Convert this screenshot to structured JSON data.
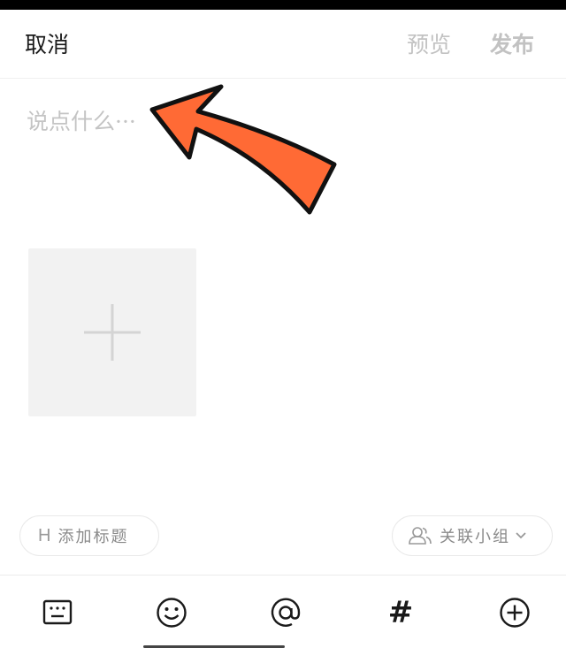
{
  "header": {
    "cancel_label": "取消",
    "preview_label": "预览",
    "publish_label": "发布"
  },
  "editor": {
    "placeholder": "说点什么···"
  },
  "options": {
    "title_icon_text": "H",
    "add_title_label": "添加标题",
    "link_group_label": "关联小组"
  },
  "toolbar": {
    "hashtag_symbol": "#"
  },
  "colors": {
    "annotation_arrow": "#ff6a35",
    "disabled_text": "#c2c2c2",
    "tile_background": "#f2f2f2"
  }
}
